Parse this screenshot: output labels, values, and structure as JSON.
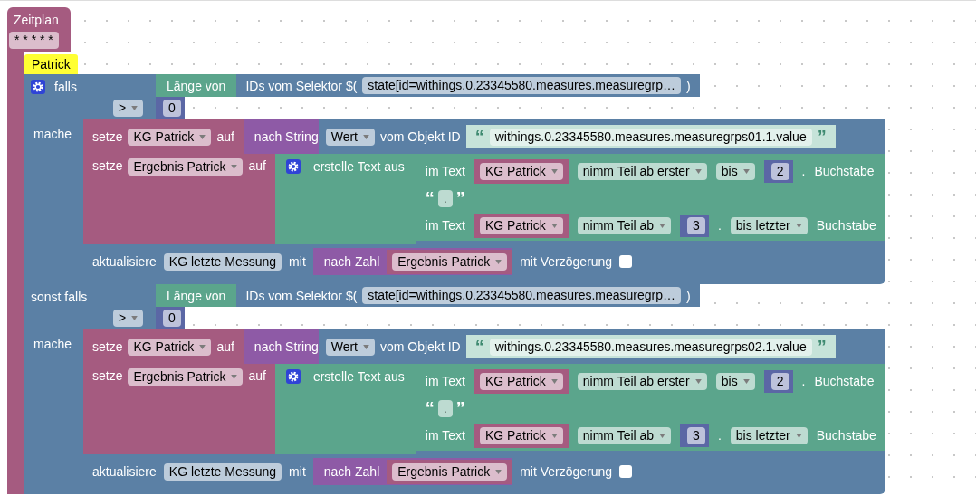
{
  "trigger": {
    "title": "Zeitplan",
    "cron": {
      "text": "* * * * *",
      "dropdown": false
    }
  },
  "comment": "Patrick",
  "branches": [
    {
      "keyword": "falls",
      "mutator": true,
      "condition": {
        "length_label": "Länge von",
        "selector_label": "IDs vom Selektor $(",
        "selector": {
          "text": "state[id=withings.0.23345580.measures.measuregrp…",
          "dropdown": false
        },
        "selector_close": ")",
        "operator": {
          "text": ">",
          "dropdown": true
        },
        "value": "0"
      },
      "do_label": "mache",
      "set_string": {
        "verb": "setze",
        "variable": {
          "text": "KG Patrick",
          "dropdown": true
        },
        "to": "auf",
        "convert": "nach String",
        "property": {
          "text": "Wert",
          "dropdown": true
        },
        "object_label": "vom Objekt ID",
        "open_quote": "“",
        "object_id": "withings.0.23345580.measures.measuregrps01.1.value",
        "close_quote": "”"
      },
      "set_join": {
        "verb": "setze",
        "variable": {
          "text": "Ergebnis Patrick",
          "dropdown": true
        },
        "to": "auf",
        "join_label": "erstelle Text aus",
        "mutator": true,
        "parts": [
          {
            "kind": "substring",
            "label": "im Text",
            "variable": {
              "text": "KG Patrick",
              "dropdown": true
            },
            "items": [
              {
                "kind": "dropdown",
                "text": "nimm Teil ab erster"
              },
              {
                "kind": "dropdown",
                "text": "bis"
              },
              {
                "kind": "number",
                "text": "2"
              },
              {
                "kind": "label",
                "text": "."
              },
              {
                "kind": "label",
                "text": "Buchstabe"
              }
            ]
          },
          {
            "kind": "literal",
            "open_quote": "“",
            "text": ".",
            "close_quote": "”"
          },
          {
            "kind": "substring",
            "label": "im Text",
            "variable": {
              "text": "KG Patrick",
              "dropdown": true
            },
            "items": [
              {
                "kind": "dropdown",
                "text": "nimm Teil ab"
              },
              {
                "kind": "number",
                "text": "3"
              },
              {
                "kind": "label",
                "text": "."
              },
              {
                "kind": "dropdown",
                "text": "bis letzter"
              },
              {
                "kind": "label",
                "text": "Buchstabe"
              }
            ]
          }
        ]
      },
      "update": {
        "verb": "aktualisiere",
        "state": {
          "text": "KG letzte Messung",
          "dropdown": false
        },
        "with": "mit",
        "convert": "nach Zahl",
        "variable": {
          "text": "Ergebnis Patrick",
          "dropdown": true
        },
        "delay_label": "mit Verzögerung",
        "delay_checked": false
      }
    },
    {
      "keyword": "sonst falls",
      "mutator": false,
      "condition": {
        "length_label": "Länge von",
        "selector_label": "IDs vom Selektor $(",
        "selector": {
          "text": "state[id=withings.0.23345580.measures.measuregrp…",
          "dropdown": false
        },
        "selector_close": ")",
        "operator": {
          "text": ">",
          "dropdown": true
        },
        "value": "0"
      },
      "do_label": "mache",
      "set_string": {
        "verb": "setze",
        "variable": {
          "text": "KG Patrick",
          "dropdown": true
        },
        "to": "auf",
        "convert": "nach String",
        "property": {
          "text": "Wert",
          "dropdown": true
        },
        "object_label": "vom Objekt ID",
        "open_quote": "“",
        "object_id": "withings.0.23345580.measures.measuregrps02.1.value",
        "close_quote": "”"
      },
      "set_join": {
        "verb": "setze",
        "variable": {
          "text": "Ergebnis Patrick",
          "dropdown": true
        },
        "to": "auf",
        "join_label": "erstelle Text aus",
        "mutator": true,
        "parts": [
          {
            "kind": "substring",
            "label": "im Text",
            "variable": {
              "text": "KG Patrick",
              "dropdown": true
            },
            "items": [
              {
                "kind": "dropdown",
                "text": "nimm Teil ab erster"
              },
              {
                "kind": "dropdown",
                "text": "bis"
              },
              {
                "kind": "number",
                "text": "2"
              },
              {
                "kind": "label",
                "text": "."
              },
              {
                "kind": "label",
                "text": "Buchstabe"
              }
            ]
          },
          {
            "kind": "literal",
            "open_quote": "“",
            "text": ".",
            "close_quote": "”"
          },
          {
            "kind": "substring",
            "label": "im Text",
            "variable": {
              "text": "KG Patrick",
              "dropdown": true
            },
            "items": [
              {
                "kind": "dropdown",
                "text": "nimm Teil ab"
              },
              {
                "kind": "number",
                "text": "3"
              },
              {
                "kind": "label",
                "text": "."
              },
              {
                "kind": "dropdown",
                "text": "bis letzter"
              },
              {
                "kind": "label",
                "text": "Buchstabe"
              }
            ]
          }
        ]
      },
      "update": {
        "verb": "aktualisiere",
        "state": {
          "text": "KG letzte Messung",
          "dropdown": false
        },
        "with": "mit",
        "convert": "nach Zahl",
        "variable": {
          "text": "Ergebnis Patrick",
          "dropdown": true
        },
        "delay_label": "mit Verzögerung",
        "delay_checked": false
      }
    }
  ]
}
